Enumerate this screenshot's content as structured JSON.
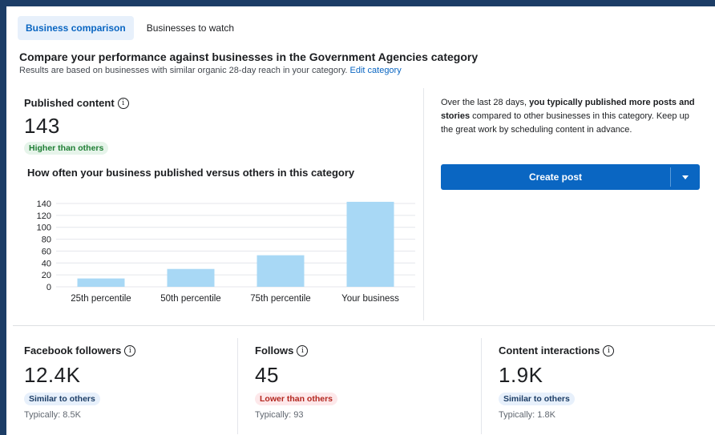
{
  "tabs": [
    {
      "label": "Business comparison",
      "active": true
    },
    {
      "label": "Businesses to watch",
      "active": false
    }
  ],
  "header": {
    "title": "Compare your performance against businesses in the Government Agencies category",
    "subtitle": "Results are based on businesses with similar organic 28-day reach in your category.",
    "edit_link": "Edit category"
  },
  "published": {
    "title": "Published content",
    "value": "143",
    "badge": "Higher than others",
    "chart_title": "How often your business published versus others in this category"
  },
  "chart_data": {
    "type": "bar",
    "categories": [
      "25th percentile",
      "50th percentile",
      "75th percentile",
      "Your business"
    ],
    "values": [
      14,
      30,
      53,
      143
    ],
    "ylim": [
      0,
      140
    ],
    "yticks": [
      0,
      20,
      40,
      60,
      80,
      100,
      120,
      140
    ],
    "grid": true,
    "color": "#a8d8f5"
  },
  "side": {
    "text_pre": "Over the last 28 days, ",
    "text_bold": "you typically published more posts and stories",
    "text_post": " compared to other businesses in this category. Keep up the great work by scheduling content in advance.",
    "button_label": "Create post"
  },
  "metrics": [
    {
      "title": "Facebook followers",
      "value": "12.4K",
      "badge": "Similar to others",
      "badge_color": "blue",
      "typical": "Typically: 8.5K"
    },
    {
      "title": "Follows",
      "value": "45",
      "badge": "Lower than others",
      "badge_color": "red",
      "typical": "Typically: 93"
    },
    {
      "title": "Content interactions",
      "value": "1.9K",
      "badge": "Similar to others",
      "badge_color": "blue",
      "typical": "Typically: 1.8K"
    }
  ],
  "colors": {
    "accent": "#0a66c2",
    "bar": "#a8d8f5",
    "frame": "#1c3d66"
  }
}
